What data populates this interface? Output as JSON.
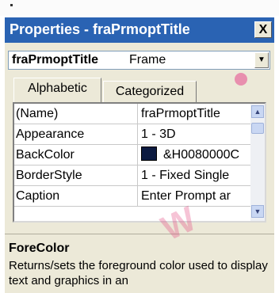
{
  "window": {
    "title": "Properties - fraPrmoptTitle",
    "close_label": "X"
  },
  "object_selector": {
    "name": "fraPrmoptTitle",
    "type": "Frame",
    "dropdown_glyph": "▼"
  },
  "tabs": [
    {
      "label": "Alphabetic",
      "active": true
    },
    {
      "label": "Categorized",
      "active": false
    }
  ],
  "properties": [
    {
      "name": "(Name)",
      "value": "fraPrmoptTitle"
    },
    {
      "name": "Appearance",
      "value": "1 - 3D"
    },
    {
      "name": "BackColor",
      "value": "&H0080000C",
      "swatch_color": "#0b1a40"
    },
    {
      "name": "BorderStyle",
      "value": "1 - Fixed Single"
    },
    {
      "name": "Caption",
      "value": "Enter Prompt ar"
    }
  ],
  "scrollbar": {
    "up_glyph": "▲",
    "down_glyph": "▼"
  },
  "description": {
    "title": "ForeColor",
    "text": "Returns/sets the foreground color used to display text and graphics in an"
  },
  "colors": {
    "titlebar": "#2a63b3",
    "panel": "#ece9d8",
    "grid_line": "#c8c8c8"
  }
}
